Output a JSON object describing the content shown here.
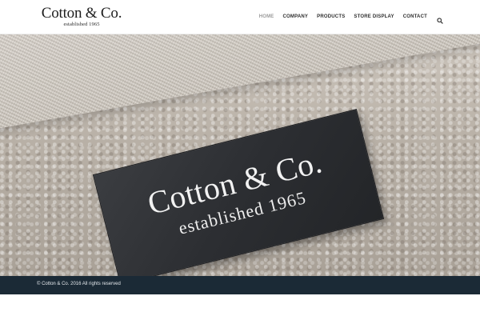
{
  "header": {
    "logo": {
      "title": "Cotton & Co.",
      "subtitle": "established 1965"
    },
    "nav": [
      {
        "label": "HOME",
        "active": true
      },
      {
        "label": "COMPANY",
        "active": false
      },
      {
        "label": "PRODUCTS",
        "active": false
      },
      {
        "label": "STORE DISPLAY",
        "active": false
      },
      {
        "label": "CONTACT",
        "active": false
      }
    ],
    "search_icon": "search-icon"
  },
  "hero": {
    "label_title": "Cotton & Co.",
    "label_subtitle": "established 1965"
  },
  "footer": {
    "copyright": "© Cotton & Co. 2016 All rights reserved"
  },
  "colors": {
    "nav_active": "#9a9a9a",
    "nav_text": "#2f2f2f",
    "footer_bg": "#1b2a36",
    "label_bg": "#2c2e32"
  }
}
